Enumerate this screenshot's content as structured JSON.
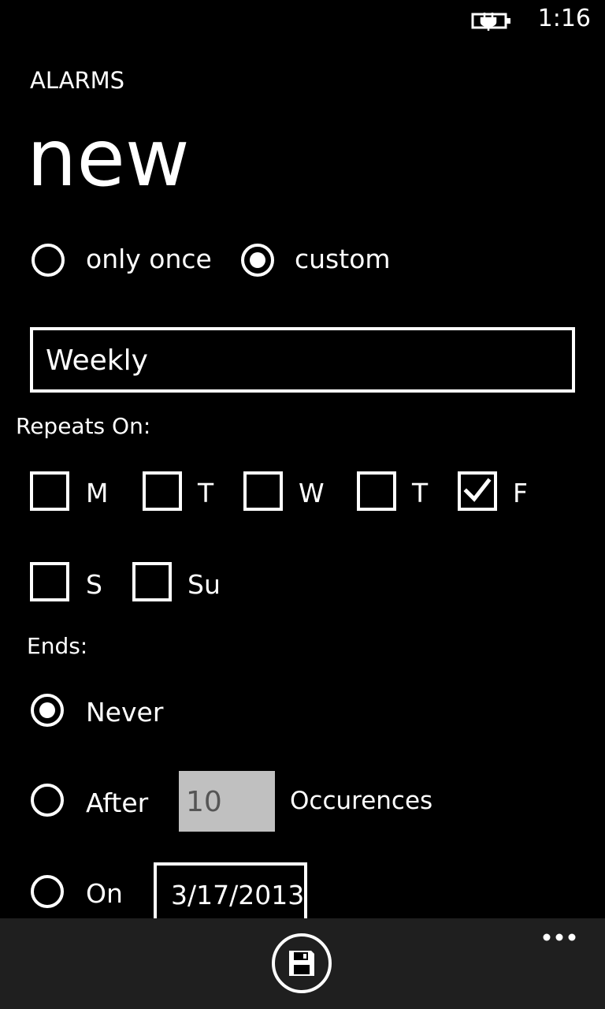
{
  "status_bar": {
    "time": "1:16",
    "battery_icon": "battery-charging-icon"
  },
  "header": {
    "app_title": "ALARMS",
    "page_title": "new"
  },
  "recurrence": {
    "options": [
      {
        "label": "only once",
        "selected": false
      },
      {
        "label": "custom",
        "selected": true
      }
    ]
  },
  "pattern_field": {
    "value": "Weekly"
  },
  "repeats_on": {
    "label": "Repeats On:",
    "days": [
      {
        "label": "M",
        "checked": false
      },
      {
        "label": "T",
        "checked": false
      },
      {
        "label": "W",
        "checked": false
      },
      {
        "label": "T",
        "checked": false
      },
      {
        "label": "F",
        "checked": true
      },
      {
        "label": "S",
        "checked": false
      },
      {
        "label": "Su",
        "checked": false
      }
    ]
  },
  "ends": {
    "label": "Ends:",
    "never": {
      "label": "Never",
      "selected": true
    },
    "after": {
      "label": "After",
      "selected": false,
      "count": "10",
      "suffix": "Occurences"
    },
    "on": {
      "label": "On",
      "selected": false,
      "date": "3/17/2013"
    }
  },
  "app_bar": {
    "primary_icon": "save-icon",
    "more_icon": "more-ellipsis-icon"
  }
}
